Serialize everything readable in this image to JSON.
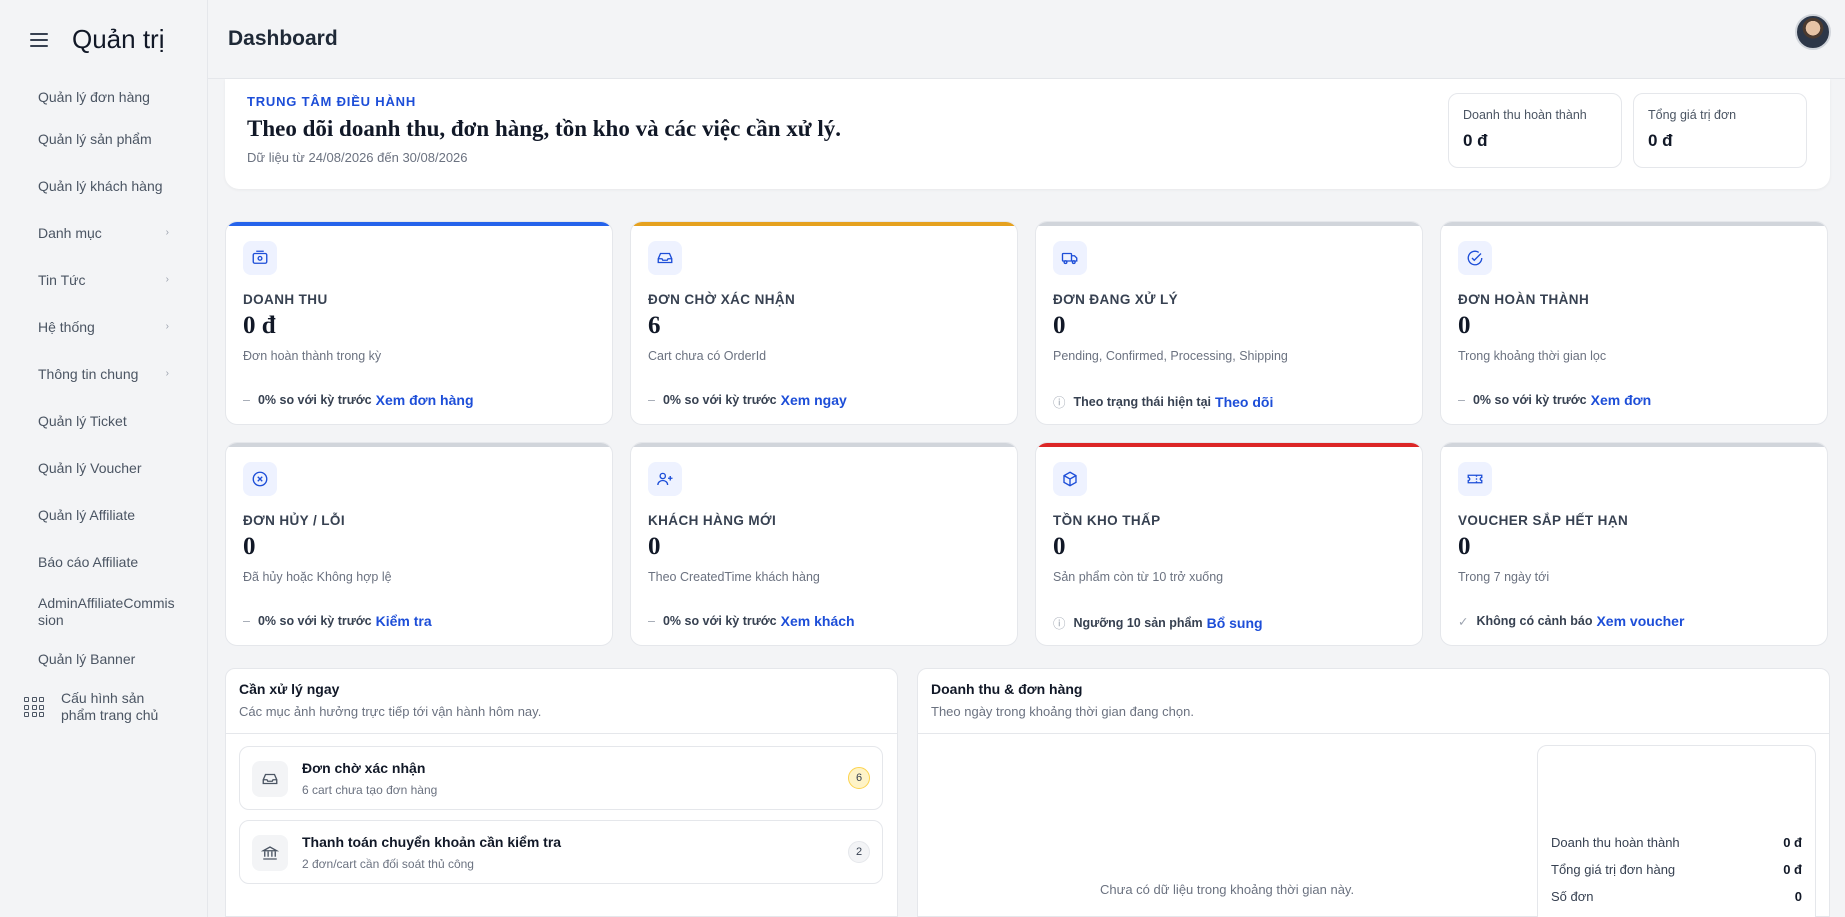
{
  "app": {
    "title": "Quản trị"
  },
  "header": {
    "page_title": "Dashboard"
  },
  "sidebar": {
    "items": [
      {
        "label": "Quản lý đơn hàng",
        "has_children": false
      },
      {
        "label": "Quản lý sản phẩm",
        "has_children": false
      },
      {
        "label": "Quản lý khách hàng",
        "has_children": false
      },
      {
        "label": "Danh mục",
        "has_children": true
      },
      {
        "label": "Tin Tức",
        "has_children": true
      },
      {
        "label": "Hệ thống",
        "has_children": true
      },
      {
        "label": "Thông tin chung",
        "has_children": true
      },
      {
        "label": "Quản lý Ticket",
        "has_children": false
      },
      {
        "label": "Quản lý Voucher",
        "has_children": false
      },
      {
        "label": "Quản lý Affiliate",
        "has_children": false
      },
      {
        "label": "Báo cáo Affiliate",
        "has_children": false
      },
      {
        "label": "AdminAffiliateCommission",
        "has_children": false
      },
      {
        "label": "Quản lý Banner",
        "has_children": false
      },
      {
        "label": "Cấu hình sản phẩm trang chủ",
        "has_children": false,
        "icon": "grid-icon"
      }
    ]
  },
  "hero": {
    "eyebrow": "TRUNG TÂM ĐIỀU HÀNH",
    "title": "Theo dõi doanh thu, đơn hàng, tồn kho và các việc cần xử lý.",
    "subtitle": "Dữ liệu từ 24/08/2026 đến 30/08/2026",
    "boxes": [
      {
        "label": "Doanh thu hoàn thành",
        "value": "0 đ"
      },
      {
        "label": "Tổng giá trị đơn",
        "value": "0 đ"
      }
    ]
  },
  "kpis": [
    {
      "title": "DOANH THU",
      "value": "0 đ",
      "desc": "Đơn hoàn thành trong kỳ",
      "marker": "–",
      "foot": "0% so với kỳ trước",
      "link": "Xem đơn hàng",
      "color": "#2563eb",
      "icon": "cash-icon"
    },
    {
      "title": "ĐƠN CHỜ XÁC NHẬN",
      "value": "6",
      "desc": "Cart chưa có OrderId",
      "marker": "–",
      "foot": "0% so với kỳ trước",
      "link": "Xem ngay",
      "color": "#e5a11f",
      "icon": "inbox-icon"
    },
    {
      "title": "ĐƠN ĐANG XỬ LÝ",
      "value": "0",
      "desc": "Pending, Confirmed, Processing, Shipping",
      "marker": "ⓘ",
      "foot": "Theo trạng thái hiện tại",
      "link": "Theo dõi",
      "color": "#d1d5db",
      "icon": "truck-icon"
    },
    {
      "title": "ĐƠN HOÀN THÀNH",
      "value": "0",
      "desc": "Trong khoảng thời gian lọc",
      "marker": "–",
      "foot": "0% so với kỳ trước",
      "link": "Xem đơn",
      "color": "#d1d5db",
      "icon": "check-circle-icon"
    },
    {
      "title": "ĐƠN HỦY / LỖI",
      "value": "0",
      "desc": "Đã hủy hoặc Không hợp lệ",
      "marker": "–",
      "foot": "0% so với kỳ trước",
      "link": "Kiểm tra",
      "color": "#d1d5db",
      "icon": "x-circle-icon"
    },
    {
      "title": "KHÁCH HÀNG MỚI",
      "value": "0",
      "desc": "Theo CreatedTime khách hàng",
      "marker": "–",
      "foot": "0% so với kỳ trước",
      "link": "Xem khách",
      "color": "#d1d5db",
      "icon": "user-plus-icon"
    },
    {
      "title": "TỒN KHO THẤP",
      "value": "0",
      "desc": "Sản phẩm còn từ 10 trở xuống",
      "marker": "ⓘ",
      "foot": "Ngưỡng 10 sản phẩm",
      "link": "Bổ sung",
      "color": "#dc2626",
      "icon": "box-icon"
    },
    {
      "title": "VOUCHER SẮP HẾT HẠN",
      "value": "0",
      "desc": "Trong 7 ngày tới",
      "marker": "✓",
      "foot": "Không có cảnh báo",
      "link": "Xem voucher",
      "color": "#d1d5db",
      "icon": "ticket-icon"
    }
  ],
  "tasks_panel": {
    "title": "Cần xử lý ngay",
    "subtitle": "Các mục ảnh hưởng trực tiếp tới vận hành hôm nay.",
    "items": [
      {
        "title": "Đơn chờ xác nhận",
        "subtitle": "6 cart chưa tạo đơn hàng",
        "count": "6",
        "badge_color": "#fef3c7",
        "badge_border": "#fcd34d",
        "icon": "inbox-icon"
      },
      {
        "title": "Thanh toán chuyển khoản cần kiểm tra",
        "subtitle": "2 đơn/cart cần đối soát thủ công",
        "count": "2",
        "badge_color": "#f3f4f6",
        "badge_border": "#e5e7eb",
        "icon": "bank-icon"
      }
    ]
  },
  "chart_panel": {
    "title": "Doanh thu & đơn hàng",
    "subtitle": "Theo ngày trong khoảng thời gian đang chọn.",
    "empty_text": "Chưa có dữ liệu trong khoảng thời gian này.",
    "summary": [
      {
        "label": "Doanh thu hoàn thành",
        "value": "0 đ"
      },
      {
        "label": "Tổng giá trị đơn hàng",
        "value": "0 đ"
      },
      {
        "label": "Số đơn",
        "value": "0"
      }
    ]
  }
}
